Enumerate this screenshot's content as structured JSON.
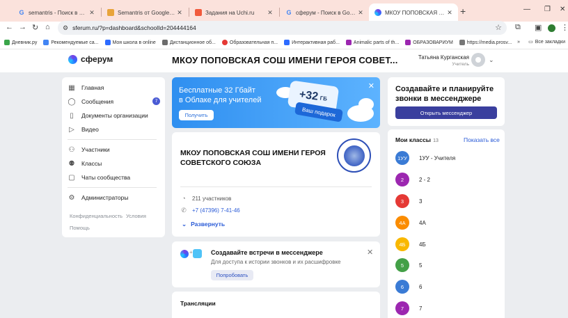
{
  "browser": {
    "tabs": [
      {
        "title": "semantris - Поиск в Google",
        "favicon": "google-icon",
        "color": "#4285f4"
      },
      {
        "title": "Semantris от Google: как ИИ пон",
        "favicon": "semantris-icon",
        "color": "#e8a43a"
      },
      {
        "title": "Задания на Uchi.ru",
        "favicon": "uchi-icon",
        "color": "#f15a3c"
      },
      {
        "title": "сферум - Поиск в Google",
        "favicon": "google-icon",
        "color": "#4285f4"
      },
      {
        "title": "МКОУ ПОПОВСКАЯ СОШ ИМЕНИ",
        "favicon": "sferum-icon",
        "color": "#5b3fe4"
      }
    ],
    "url": "sferum.ru/?p=dashboard&schoolId=204444164",
    "bookmarks": [
      {
        "label": "Дневник.ру",
        "color": "#3aa54a"
      },
      {
        "label": "Рекомендуемые са...",
        "color": "#4285f4"
      },
      {
        "label": "Моя школа в online",
        "color": "#2d6bff"
      },
      {
        "label": "Дистанционное об...",
        "color": "#6c6c6c"
      },
      {
        "label": "Образовательная п...",
        "color": "#e53935"
      },
      {
        "label": "Интерактивная раб...",
        "color": "#2d6bff"
      },
      {
        "label": "Animalic parts of th...",
        "color": "#9c27b0"
      },
      {
        "label": "ОБРАЗОВАРИУМ",
        "color": "#9c27b0"
      },
      {
        "label": "https://media.prosv...",
        "color": "#777777"
      }
    ],
    "all_bookmarks": "Все закладки"
  },
  "header": {
    "logo": "сферум",
    "org_title": "МКОУ ПОПОВСКАЯ СОШ ИМЕНИ ГЕРОЯ СОВЕТ...",
    "user_name": "Татьяна Курганская",
    "user_role": "Учитель"
  },
  "nav": {
    "items": [
      {
        "label": "Главная",
        "icon": "home-grid-icon"
      },
      {
        "label": "Сообщения",
        "icon": "chat-icon",
        "badge": "7"
      },
      {
        "label": "Документы организации",
        "icon": "document-icon"
      },
      {
        "label": "Видео",
        "icon": "play-icon"
      },
      {
        "label": "Участники",
        "icon": "people-icon"
      },
      {
        "label": "Классы",
        "icon": "classes-icon"
      },
      {
        "label": "Чаты сообщества",
        "icon": "chats-icon"
      },
      {
        "label": "Администраторы",
        "icon": "admin-icon"
      }
    ],
    "privacy": "Конфиденциальность",
    "terms": "Условия",
    "help": "Помощь"
  },
  "banner": {
    "title_line1": "Бесплатные 32 Гбайт",
    "title_line2": "в Облаке для учителей",
    "button": "Получить",
    "gb": "+32",
    "gb_unit": "ГБ",
    "gift": "Ваш подарок"
  },
  "org": {
    "name": "МКОУ ПОПОВСКАЯ СОШ ИМЕНИ ГЕРОЯ СОВЕТСКОГО СОЮЗА",
    "members": "211 участников",
    "phone": "+7 (47396) 7-41-46",
    "expand": "Развернуть"
  },
  "meetings": {
    "title": "Создавайте встречи в мессенджере",
    "subtitle": "Для доступа к истории звонков и их расшифровке",
    "button": "Попробовать"
  },
  "broadcasts": {
    "title": "Трансляции"
  },
  "calls": {
    "title": "Создавайте и планируйте звонки в мессенджере",
    "button": "Открыть мессенджер"
  },
  "classes": {
    "title": "Мои классы",
    "count": "13",
    "show_all": "Показать все",
    "items": [
      {
        "badge": "1УУ",
        "name": "1УУ - Учителя",
        "color": "#3a7bd5"
      },
      {
        "badge": "2",
        "name": "2 - 2",
        "color": "#9c27b0"
      },
      {
        "badge": "3",
        "name": "3",
        "color": "#e53935"
      },
      {
        "badge": "4А",
        "name": "4А",
        "color": "#fb8c00"
      },
      {
        "badge": "4Б",
        "name": "4Б",
        "color": "#f9b800"
      },
      {
        "badge": "5",
        "name": "5",
        "color": "#43a047"
      },
      {
        "badge": "6",
        "name": "6",
        "color": "#3a7bd5"
      },
      {
        "badge": "7",
        "name": "7",
        "color": "#9c27b0"
      }
    ]
  }
}
